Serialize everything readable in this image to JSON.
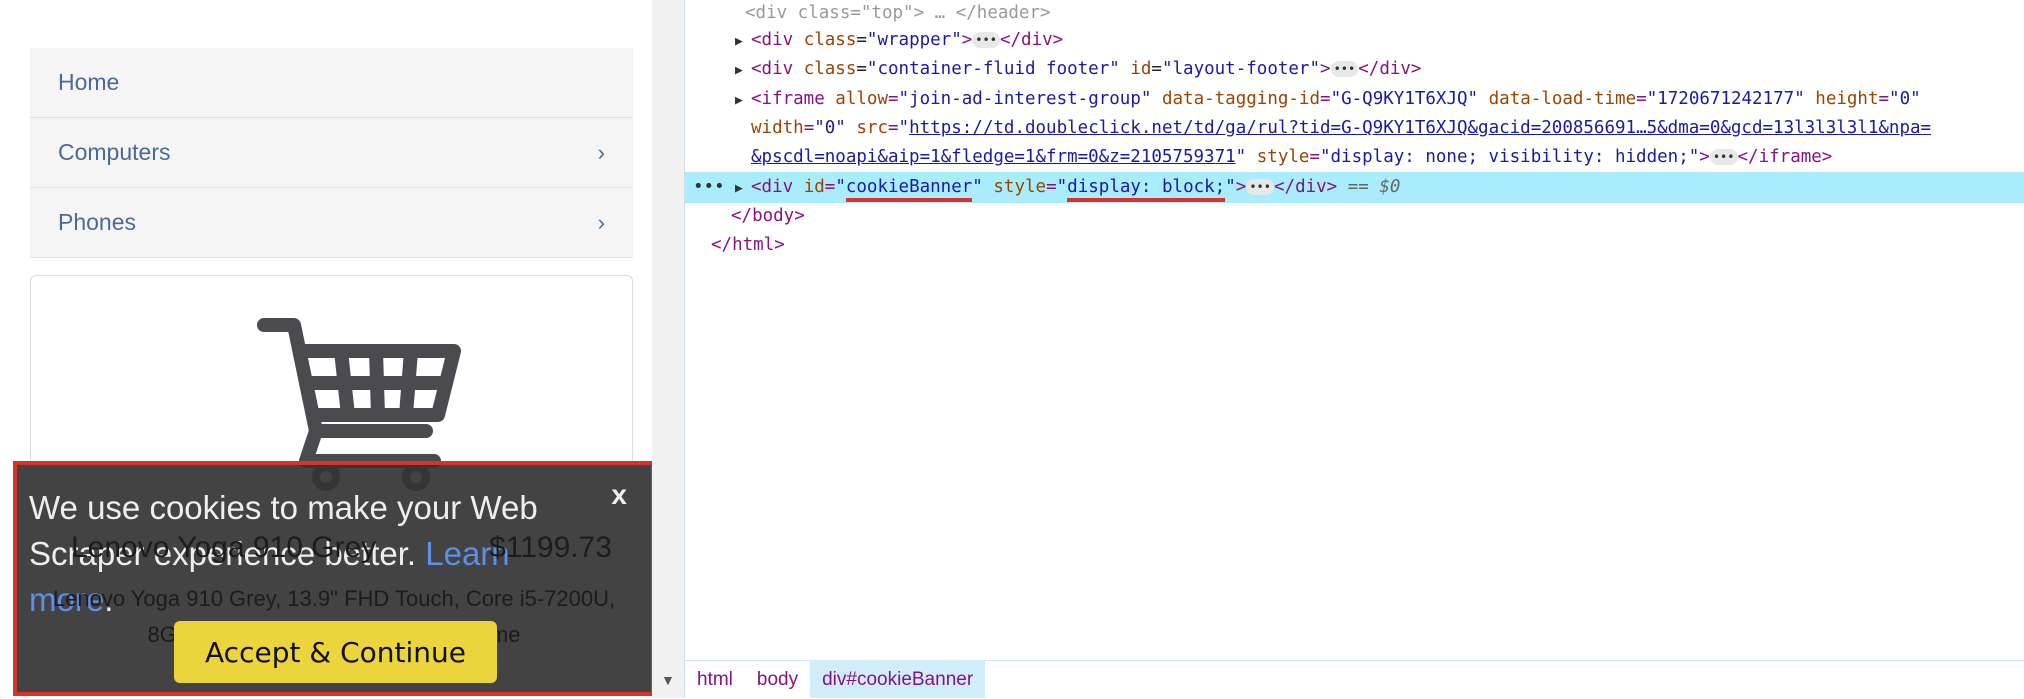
{
  "sidebar": {
    "items": [
      {
        "label": "Home",
        "chevron": false
      },
      {
        "label": "Computers",
        "chevron": true
      },
      {
        "label": "Phones",
        "chevron": true
      }
    ]
  },
  "product": {
    "icon": "shopping-cart-icon",
    "title": "Lenovo Yoga 910 Grey",
    "price": "$1199.73",
    "description": "Lenovo Yoga 910 Grey, 13.9\" FHD Touch, Core i5-7200U, 8GB, 256GB SSD, Windows 10 Home"
  },
  "cookie_banner": {
    "text": "We use cookies to make your Web Scraper experience better.",
    "link": "Learn more",
    "after_link": ".",
    "close": "x",
    "accept": "Accept & Continue",
    "border_color": "#d9322b",
    "button_color": "#ecd43c"
  },
  "devtools": {
    "lines": {
      "top": "<div class=\"top\"> … </header>",
      "wrapper": {
        "tag": "<div ",
        "an": "class",
        "av": "\"wrapper\"",
        "close": "</div>"
      },
      "footer": {
        "tag": "<div ",
        "an1": "class",
        "av1": "\"container-fluid footer\"",
        "an2": "id",
        "av2": "\"layout-footer\"",
        "close": "</div>"
      },
      "iframe1": "join-ad-interest-group",
      "iframe_tagging": "\"G-Q9KY1T6XJQ\"",
      "iframe_load": "\"1720671242177\"",
      "iframe_height": "\"0\"",
      "iframe_width": "\"0\"",
      "iframe_src1": "https://td.doubleclick.net/td/ga/rul?tid=G-Q9KY1T6XJQ&gacid=200856691…5&dma=0&gcd=13l3l3l3l1&npa=",
      "iframe_src2": "&pscdl=noapi&aip=1&fledge=1&frm=0&z=2105759371",
      "iframe_style": "\"display: none; visibility: hidden;\"",
      "cookie_id": "cookieBanner",
      "cookie_style": "display: block;",
      "selected_marker": "== $0",
      "body_close": "</body>",
      "html_close": "</html>"
    },
    "breadcrumbs": [
      "html",
      "body",
      "div#cookieBanner"
    ]
  }
}
